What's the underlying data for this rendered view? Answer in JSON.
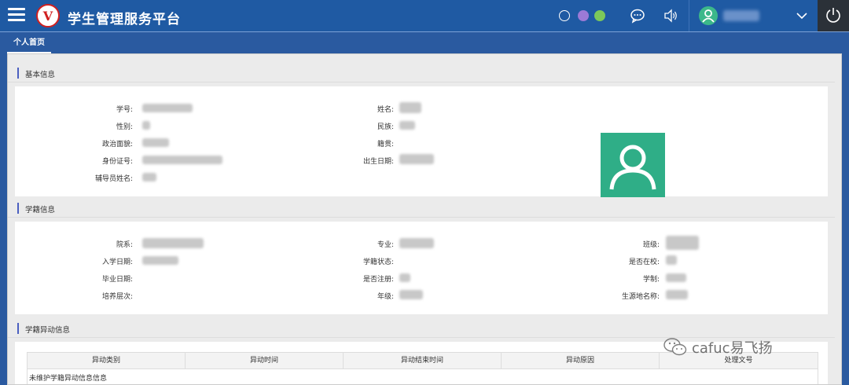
{
  "header": {
    "app_title": "学生管理服务平台",
    "logo_text": "V",
    "theme_colors": [
      "#ffffff",
      "#9c7ad6",
      "#7cc85a"
    ],
    "accent_color": "#1f5aa3"
  },
  "tabs": [
    {
      "label": "个人首页",
      "active": true
    }
  ],
  "sections": {
    "basic": {
      "title": "基本信息",
      "labels": {
        "student_id": "学号:",
        "name": "姓名:",
        "gender": "性别:",
        "ethnicity": "民族:",
        "political": "政治面貌:",
        "native_place": "籍贯:",
        "id_number": "身份证号:",
        "birth_date": "出生日期:",
        "counselor": "辅导员姓名:"
      }
    },
    "enrollment": {
      "title": "学籍信息",
      "labels": {
        "college": "院系:",
        "major": "专业:",
        "class": "班级:",
        "enroll_date": "入学日期:",
        "status": "学籍状态:",
        "on_campus": "是否在校:",
        "grad_date": "毕业日期:",
        "registered": "是否注册:",
        "duration": "学制:",
        "level": "培养层次:",
        "grade": "年级:",
        "origin": "生源地名称:"
      }
    },
    "changes": {
      "title": "学籍异动信息",
      "columns": [
        "异动类别",
        "异动时间",
        "异动结束时间",
        "异动原因",
        "处理文号"
      ],
      "empty_text": "未维护学籍异动信息信息"
    }
  },
  "watermark": {
    "text": "cafuc易飞扬"
  }
}
